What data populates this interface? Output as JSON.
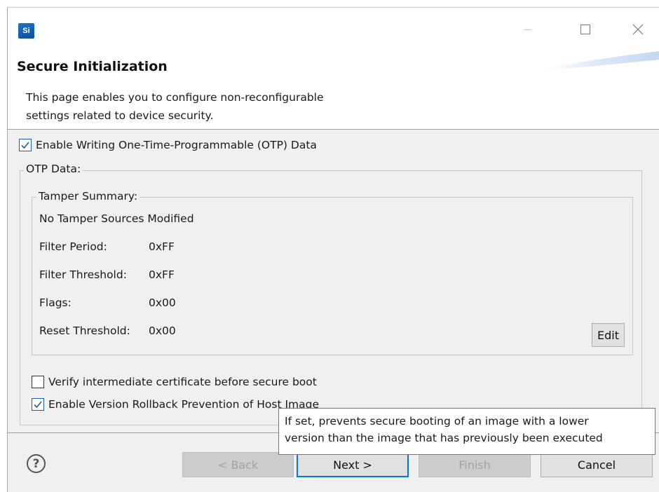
{
  "window": {
    "logo_text": "Si"
  },
  "header": {
    "title": "Secure Initialization"
  },
  "description": {
    "line1": "This page enables you to configure non-reconfigurable",
    "line2": "settings related to device security."
  },
  "otp": {
    "enable_label": "Enable Writing One-Time-Programmable (OTP) Data",
    "enable_checked": true,
    "group_title": "OTP Data:"
  },
  "tamper": {
    "group_title": "Tamper Summary:",
    "status": "No Tamper Sources Modified",
    "rows": [
      {
        "label": "Filter Period:",
        "value": "0xFF"
      },
      {
        "label": "Filter Threshold:",
        "value": "0xFF"
      },
      {
        "label": "Flags:",
        "value": "0x00"
      },
      {
        "label": "Reset Threshold:",
        "value": "0x00"
      }
    ],
    "edit_label": "Edit"
  },
  "options": {
    "verify_label": "Verify intermediate certificate before secure boot",
    "verify_checked": false,
    "rollback_label": "Enable Version Rollback Prevention of Host Image",
    "rollback_checked": true
  },
  "tooltip": {
    "line1": "If set, prevents secure booting of an image with a lower",
    "line2": "version than the image that has previously been executed"
  },
  "footer": {
    "help_glyph": "?",
    "back_label": "< Back",
    "next_label": "Next >",
    "finish_label": "Finish",
    "cancel_label": "Cancel"
  },
  "colors": {
    "accent": "#0078d7",
    "dialog_bg": "#f0f0f0",
    "checkbox_check": "#1a5fb4"
  }
}
